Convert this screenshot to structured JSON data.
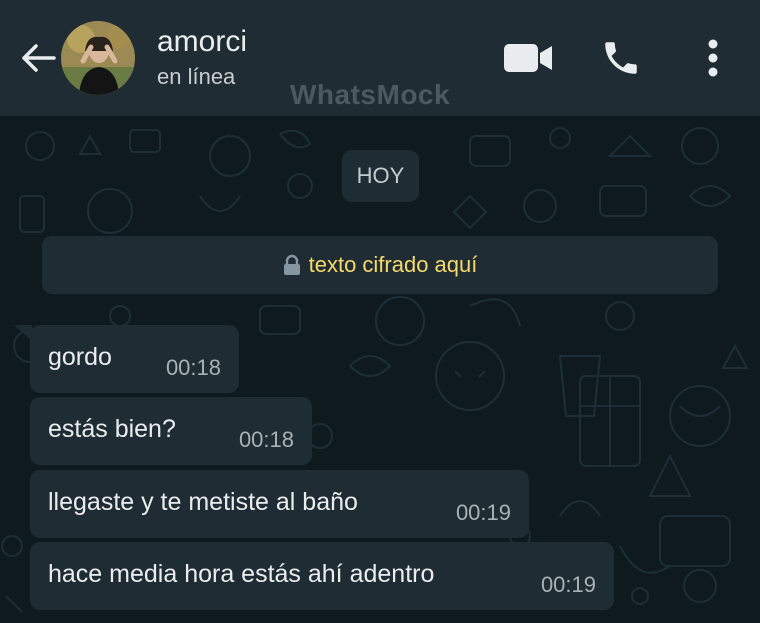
{
  "header": {
    "contact_name": "amorci",
    "contact_status": "en línea",
    "watermark": "WhatsMock",
    "icons": [
      "back-arrow-icon",
      "video-call-icon",
      "phone-icon",
      "more-options-icon"
    ]
  },
  "chat": {
    "date_label": "HOY",
    "encryption_text": "texto cifrado aquí",
    "messages": [
      {
        "text": "gordo",
        "time": "00:18"
      },
      {
        "text": "estás bien?",
        "time": "00:18"
      },
      {
        "text": "llegaste y te metiste al baño",
        "time": "00:19"
      },
      {
        "text": "hace media hora estás ahí adentro",
        "time": "00:19"
      }
    ]
  },
  "colors": {
    "header_bg": "#202c33",
    "chat_bg": "#0b141a",
    "bubble_bg": "#202c33",
    "encryption_text": "#f6d96b"
  }
}
